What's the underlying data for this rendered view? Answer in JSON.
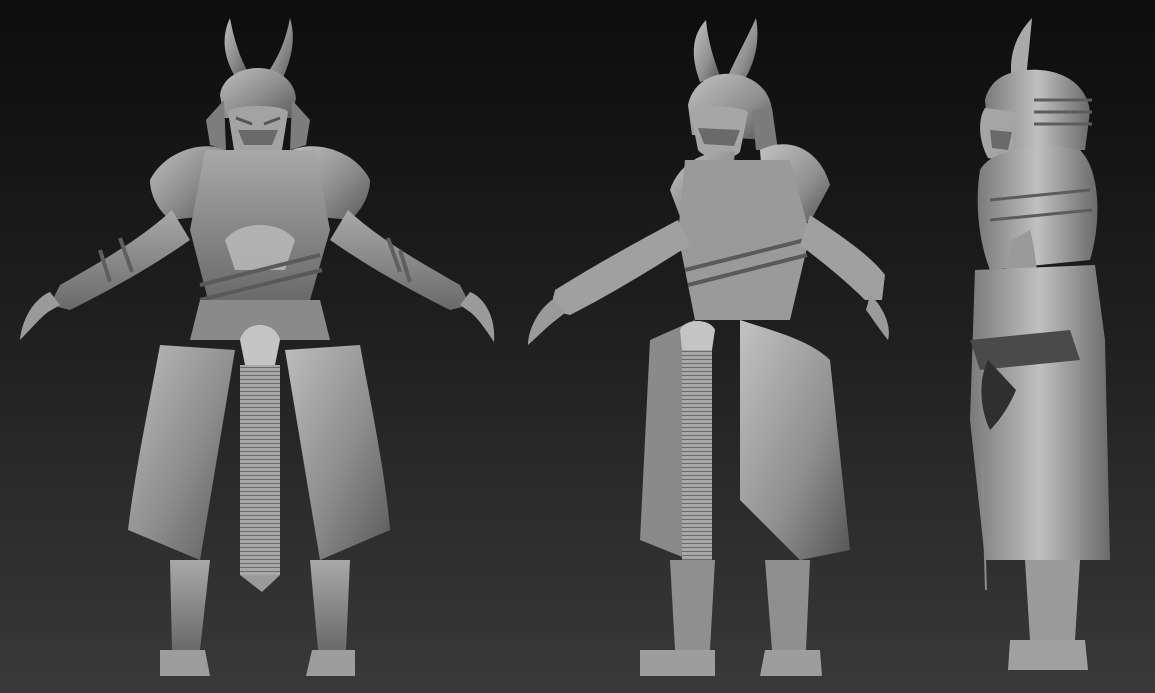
{
  "scene": {
    "background_top": "#0d0d0d",
    "background_bottom": "#393939",
    "material_light": "#b9b9b9",
    "material_mid": "#8e8e8e",
    "material_dark": "#575757",
    "views": [
      {
        "view": "front"
      },
      {
        "view": "three-quarter"
      },
      {
        "view": "side"
      }
    ]
  }
}
